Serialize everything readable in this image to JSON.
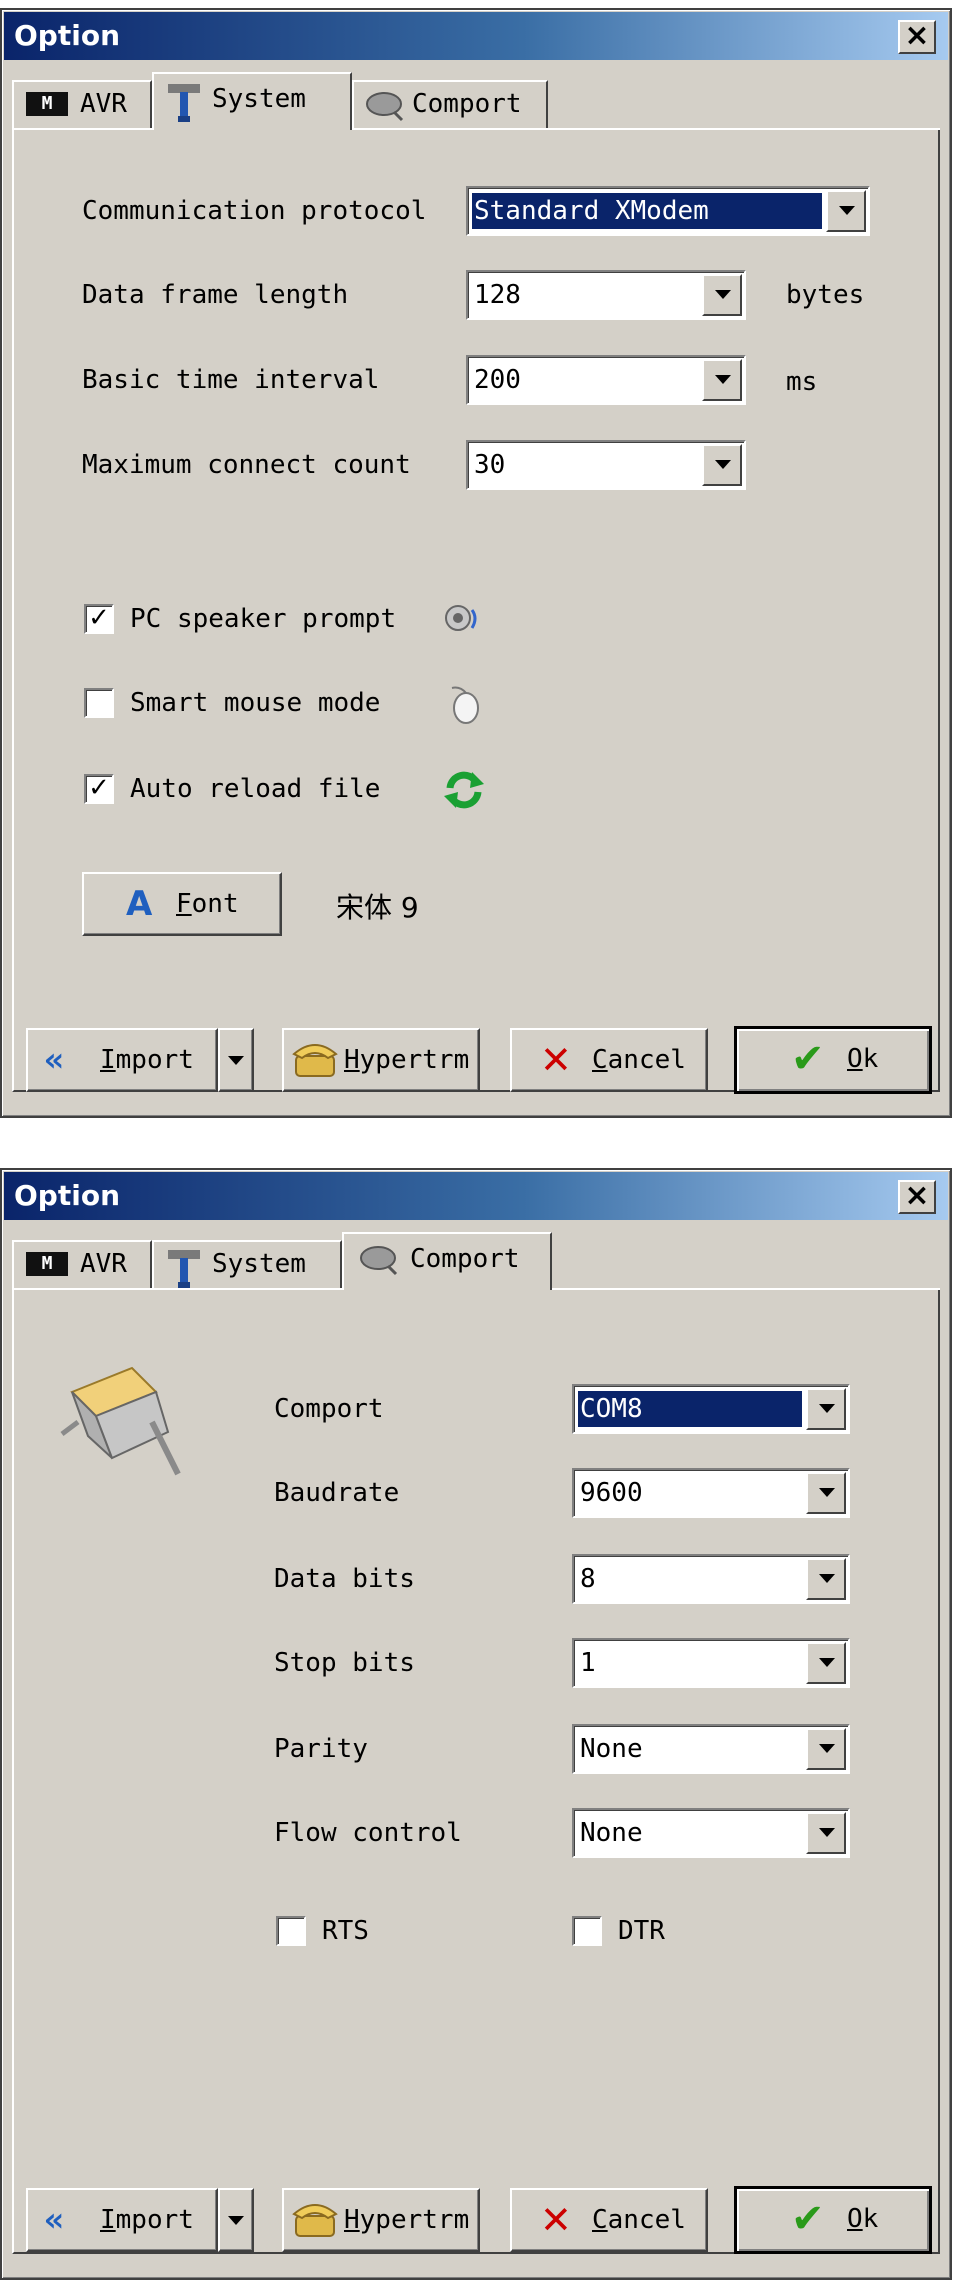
{
  "top": {
    "title": "Option",
    "close_glyph": "×",
    "tabs": [
      "AVR",
      "System",
      "Comport"
    ],
    "tab_avr_badge": "M",
    "active_tab": "System",
    "fields": [
      {
        "label": "Communication protocol",
        "value": "Standard XModem",
        "unit": ""
      },
      {
        "label": "Data frame length",
        "value": "128",
        "unit": "bytes"
      },
      {
        "label": "Basic time interval",
        "value": "200",
        "unit": "ms"
      },
      {
        "label": "Maximum connect count",
        "value": "30",
        "unit": ""
      }
    ],
    "checkboxes": [
      {
        "label": "PC speaker prompt",
        "checked": true,
        "check_glyph": "✓",
        "icon": "speaker-icon"
      },
      {
        "label": "Smart mouse mode",
        "checked": false,
        "check_glyph": "",
        "icon": "mouse-icon"
      },
      {
        "label": "Auto reload file",
        "checked": true,
        "check_glyph": "✓",
        "icon": "refresh-icon"
      }
    ],
    "font_button": {
      "letter": "A",
      "underlined": "F",
      "rest": "ont"
    },
    "font_value": "宋体 9"
  },
  "bottom": {
    "title": "Option",
    "close_glyph": "×",
    "tabs": [
      "AVR",
      "System",
      "Comport"
    ],
    "tab_avr_badge": "M",
    "active_tab": "Comport",
    "fields": [
      {
        "label": "Comport",
        "value": "COM8"
      },
      {
        "label": "Baudrate",
        "value": "9600"
      },
      {
        "label": "Data bits",
        "value": "8"
      },
      {
        "label": "Stop bits",
        "value": "1"
      },
      {
        "label": "Parity",
        "value": "None"
      },
      {
        "label": "Flow control",
        "value": "None"
      }
    ],
    "checkboxes": [
      {
        "label": "RTS",
        "checked": false
      },
      {
        "label": "DTR",
        "checked": false
      }
    ]
  },
  "buttons": {
    "import": {
      "underlined": "I",
      "rest": "mport"
    },
    "hypertrm": {
      "underlined": "H",
      "rest": "ypertrm"
    },
    "cancel": {
      "underlined": "C",
      "rest": "ancel"
    },
    "ok": {
      "underlined": "O",
      "rest": "k"
    }
  },
  "colors": {
    "face": "#d4d0c8",
    "title_start": "#0a246a",
    "title_end": "#a6caf0",
    "selection": "#0a246a",
    "font_icon": "#1f5fbf",
    "cancel_x": "#cc0000",
    "ok_check": "#2a9a1a",
    "refresh": "#1aa033"
  }
}
